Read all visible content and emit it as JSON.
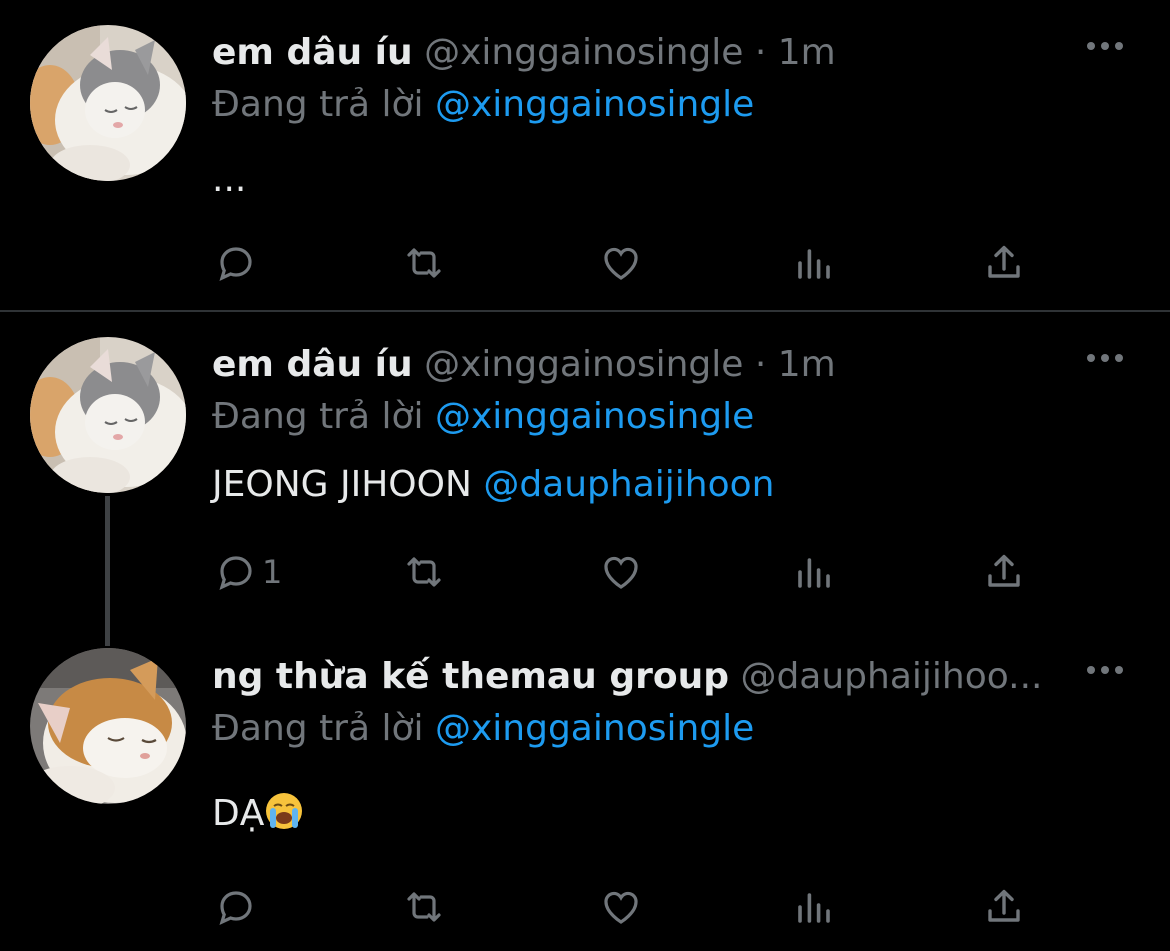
{
  "tweets": [
    {
      "display_name": "em dâu íu",
      "handle": "@xinggainosingle",
      "dot": "·",
      "time": "1m",
      "replying_prefix": "Đang trả lời",
      "replying_to": "@xinggainosingle",
      "text": "...",
      "mention": "",
      "reply_count": "",
      "more_label": "•••"
    },
    {
      "display_name": "em dâu íu",
      "handle": "@xinggainosingle",
      "dot": "·",
      "time": "1m",
      "replying_prefix": "Đang trả lời",
      "replying_to": "@xinggainosingle",
      "text": "JEONG JIHOON",
      "mention": "@dauphaijihoon",
      "reply_count": "1",
      "more_label": "•••"
    },
    {
      "display_name": "ng thừa kế themau group",
      "handle": "@dauphaijihoo...",
      "dot": "",
      "time": "",
      "replying_prefix": "Đang trả lời",
      "replying_to": "@xinggainosingle",
      "text": "DẠ",
      "mention": "",
      "reply_count": "",
      "more_label": "•••"
    }
  ],
  "icons": {
    "reply": "reply-icon",
    "retweet": "retweet-icon",
    "like": "heart-icon",
    "views": "views-icon",
    "share": "share-icon",
    "more": "more-icon",
    "emoji": "crying-face-emoji"
  },
  "colors": {
    "background": "#000000",
    "text": "#e7e9ea",
    "muted": "#71767b",
    "link": "#1d9bf0",
    "divider": "#2f3336"
  }
}
